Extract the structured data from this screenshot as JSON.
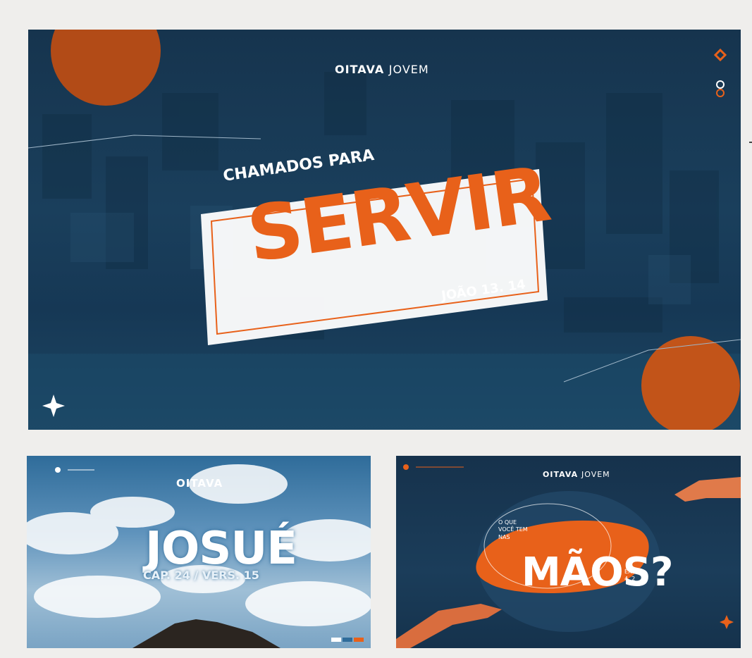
{
  "hero": {
    "brand_bold": "OITAVA",
    "brand_light": "JOVEM",
    "tagline": "CHAMADOS PARA",
    "title": "SERVIR",
    "reference": "JOÃO 13. 14",
    "colors": {
      "accent": "#e8611a",
      "bg": "#17384f"
    }
  },
  "josue": {
    "brand": "OITAVA",
    "title": "JOSUÉ",
    "subtitle": "CAP. 24 / VERS. 15"
  },
  "maos": {
    "brand_bold": "OITAVA",
    "brand_light": "JOVEM",
    "question": "O QUE VOCÊ TEM NAS",
    "title": "MÃOS?",
    "reference_line1": "ÊXODO",
    "reference_line2": "4. 2"
  }
}
